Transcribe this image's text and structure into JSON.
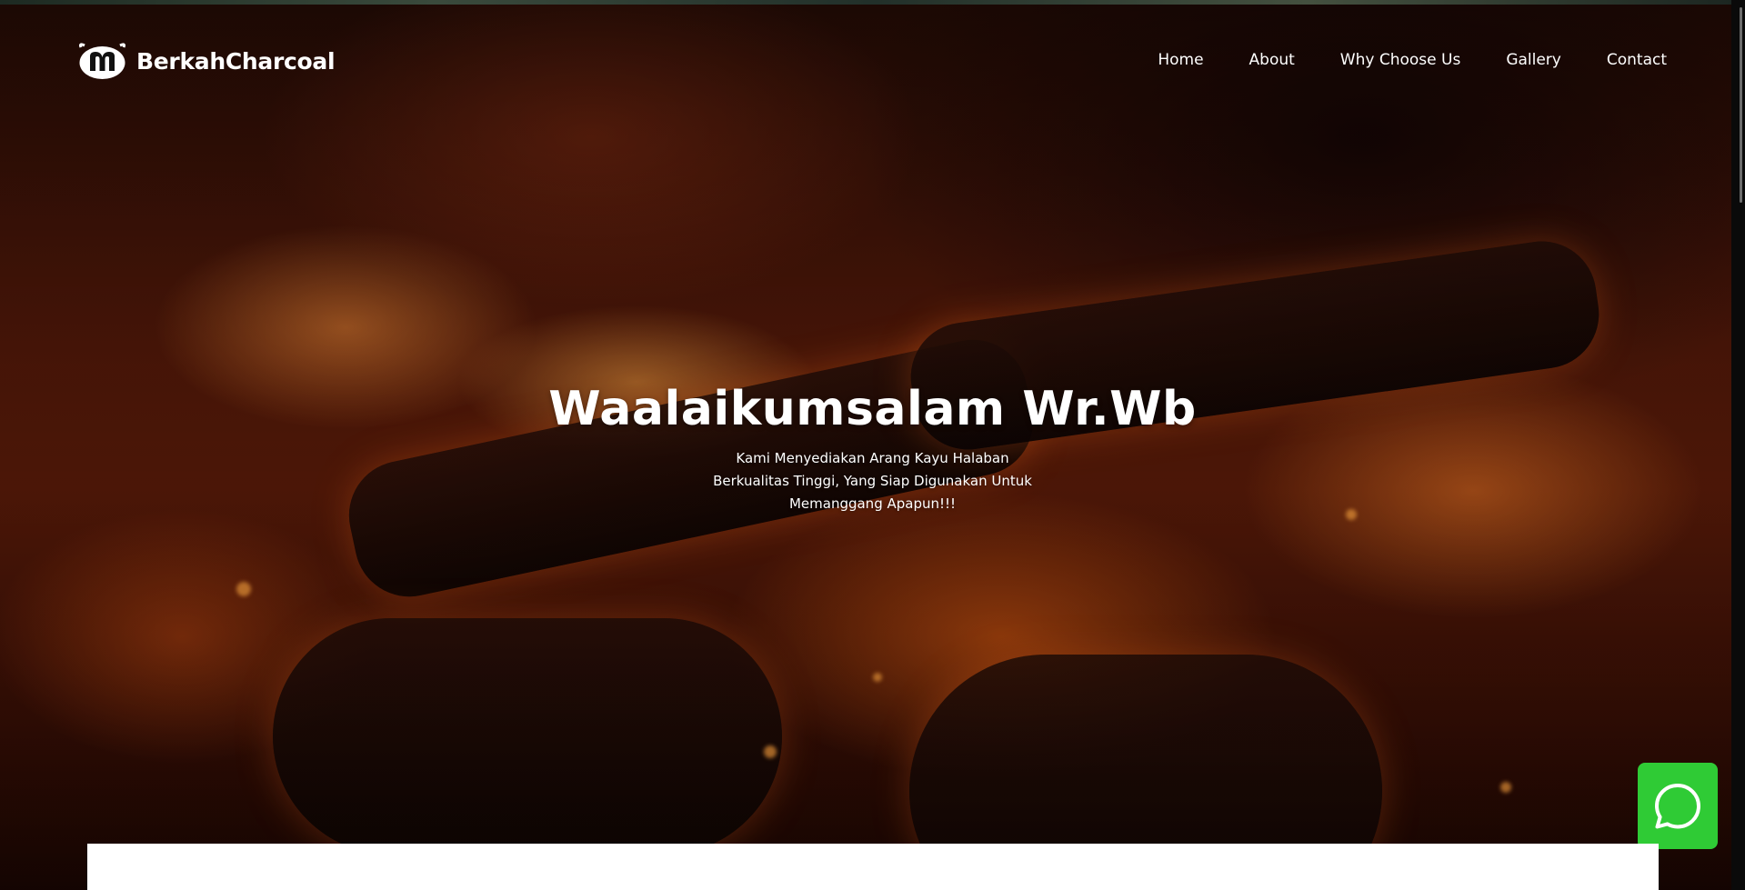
{
  "brand": {
    "name": "BerkahCharcoal",
    "logo_icon": "charcoal-m-logo-icon"
  },
  "nav": {
    "items": [
      {
        "label": "Home"
      },
      {
        "label": "About"
      },
      {
        "label": "Why Choose Us"
      },
      {
        "label": "Gallery"
      },
      {
        "label": "Contact"
      }
    ]
  },
  "hero": {
    "title": "Waalaikumsalam Wr.Wb",
    "subtitle": "Kami Menyediakan Arang Kayu Halaban Berkualitas Tinggi, Yang Siap Digunakan Untuk Memanggang Apapun!!!",
    "background": "campfire-embers-image"
  },
  "whatsapp": {
    "icon": "whatsapp-icon",
    "color": "#2fcb35"
  }
}
